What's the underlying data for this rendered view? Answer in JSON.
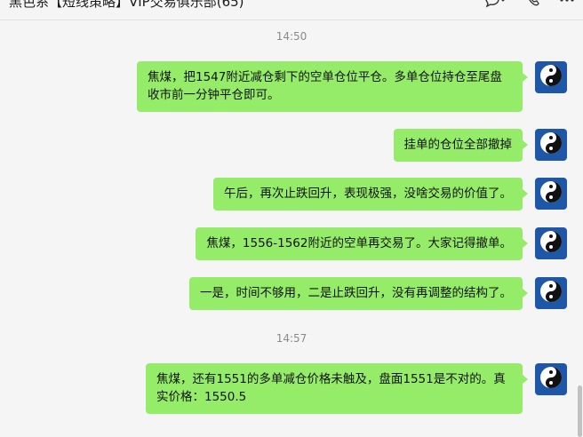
{
  "header": {
    "title": "黑色系【短线策略】VIP交易俱乐部(65)"
  },
  "timestamps": [
    "14:50",
    "14:57"
  ],
  "messages": [
    {
      "text": "焦煤，把1547附近减仓剩下的空单仓位平仓。多单仓位持仓至尾盘收市前一分钟平仓即可。"
    },
    {
      "text": "挂单的仓位全部撤掉"
    },
    {
      "text": "午后，再次止跌回升，表现极强，没啥交易的价值了。"
    },
    {
      "text": "焦煤，1556-1562附近的空单再交易了。大家记得撤单。"
    },
    {
      "text": "一是，时间不够用，二是止跌回升，没有再调整的结构了。"
    },
    {
      "text": "焦煤，还有1551的多单减仓价格未触及，盘面1551是不对的。真实价格：1550.5"
    }
  ],
  "colors": {
    "bubble": "#95ec69",
    "avatar": "#1f57a8",
    "background": "#f5f5f5"
  },
  "icons": [
    "chat-icon",
    "phone-icon",
    "more-icon",
    "yin-yang-icon"
  ]
}
